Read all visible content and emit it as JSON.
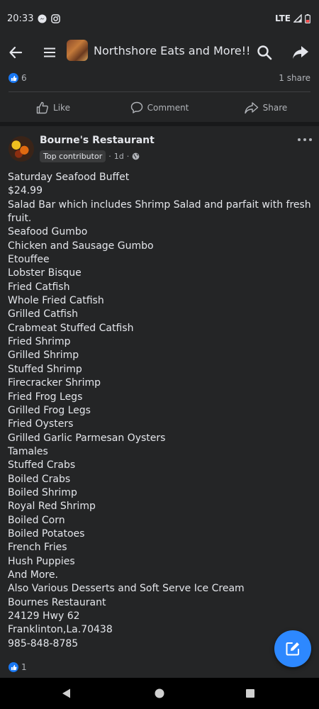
{
  "status_bar": {
    "time": "20:33",
    "network": "LTE"
  },
  "header": {
    "group_title": "Northshore Eats and More!!"
  },
  "prev_post": {
    "like_count": "6",
    "share_count": "1 share"
  },
  "actions": {
    "like": "Like",
    "comment": "Comment",
    "share": "Share"
  },
  "post": {
    "author": "Bourne's Restaurant",
    "badge": "Top contributor",
    "time": "1d",
    "lines": [
      "Saturday Seafood Buffet",
      "$24.99",
      "Salad Bar which includes Shrimp Salad and parfait with fresh",
      "fruit.",
      "Seafood Gumbo",
      "Chicken and Sausage Gumbo",
      "Etouffee",
      "Lobster Bisque",
      "Fried Catfish",
      "Whole Fried Catfish",
      "Grilled Catfish",
      "Crabmeat Stuffed Catfish",
      "Fried Shrimp",
      "Grilled Shrimp",
      "Stuffed Shrimp",
      "Firecracker Shrimp",
      "Fried Frog Legs",
      "Grilled Frog Legs",
      "Fried Oysters",
      "Grilled Garlic Parmesan Oysters",
      "Tamales",
      "Stuffed Crabs",
      "Boiled Crabs",
      "Boiled Shrimp",
      "Royal Red Shrimp",
      "Boiled Corn",
      "Boiled Potatoes",
      "French Fries",
      "Hush Puppies",
      "And More.",
      "Also Various Desserts and Soft Serve Ice Cream",
      "Bournes Restaurant",
      "24129 Hwy 62",
      "Franklinton,La.70438",
      "985-848-8785"
    ],
    "like_count": "1"
  },
  "icons": {
    "back": "arrow-left-icon",
    "menu": "hamburger-icon",
    "search": "search-icon",
    "share": "share-arrow-icon",
    "fab": "compose-icon"
  },
  "colors": {
    "accent": "#2d88ff",
    "like": "#1877f2",
    "background": "#18191a",
    "surface": "#242526"
  }
}
